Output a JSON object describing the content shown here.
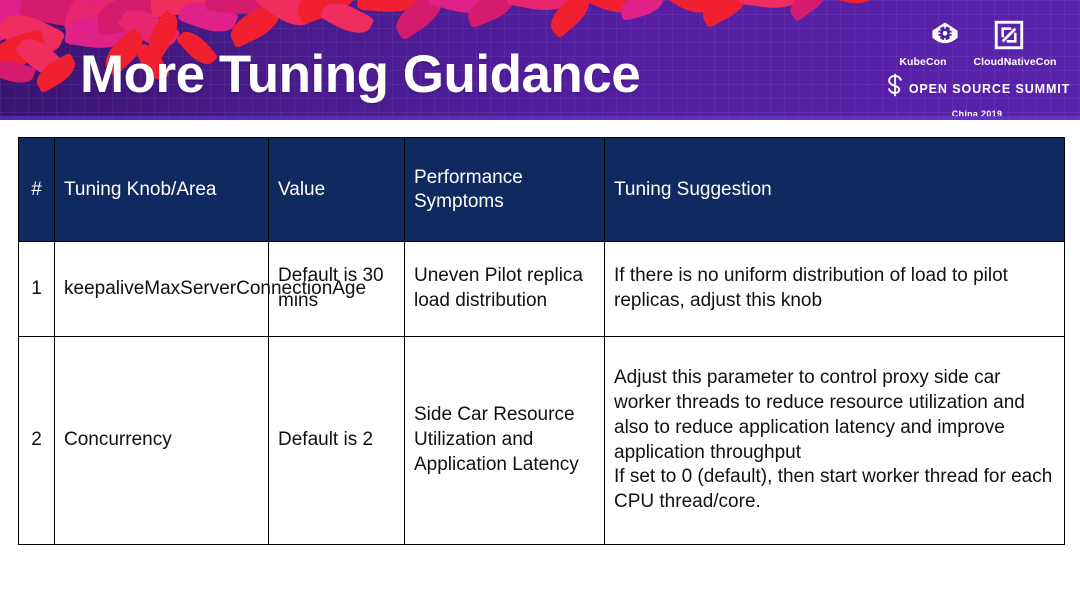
{
  "slide": {
    "title": "More Tuning Guidance"
  },
  "branding": {
    "kubecon_label": "KubeCon",
    "cloudnativecon_label": "CloudNativeCon",
    "summit_label": "OPEN SOURCE SUMMIT",
    "year_label": "China 2019",
    "kubecon_icon": "kubernetes-helm-icon",
    "cloudnativecon_icon": "cloud-native-square-icon",
    "summit_icon": "open-source-summit-s-icon"
  },
  "colors": {
    "banner_purple_dark": "#3a1370",
    "banner_purple_light": "#5a22ab",
    "leaf_red": "#f02030",
    "leaf_pink": "#e0218a",
    "leaf_magenta": "#d41b6e",
    "table_header_navy": "#0e2a5e",
    "table_border": "#000000",
    "text_white": "#ffffff",
    "text_body": "#111111"
  },
  "table": {
    "columns": [
      {
        "key": "num",
        "label": "#"
      },
      {
        "key": "knob",
        "label": "Tuning Knob/Area"
      },
      {
        "key": "value",
        "label": "Value"
      },
      {
        "key": "symptoms",
        "label": "Performance\nSymptoms"
      },
      {
        "key": "suggestion",
        "label": "Tuning Suggestion"
      }
    ],
    "rows": [
      {
        "num": "1",
        "knob": "keepaliveMaxServerConnectionAge",
        "value": "Default is 30 mins",
        "symptoms": "Uneven Pilot replica load distribution",
        "suggestion": "If there is no uniform distribution of load to pilot replicas, adjust this knob"
      },
      {
        "num": "2",
        "knob": "Concurrency",
        "value": "Default is 2",
        "symptoms": "Side Car Resource Utilization and Application Latency",
        "suggestion": "Adjust this parameter to control proxy side car worker threads to reduce resource utilization and also to reduce application latency and improve application throughput\nIf set to 0 (default), then start worker thread for each CPU thread/core."
      }
    ]
  }
}
